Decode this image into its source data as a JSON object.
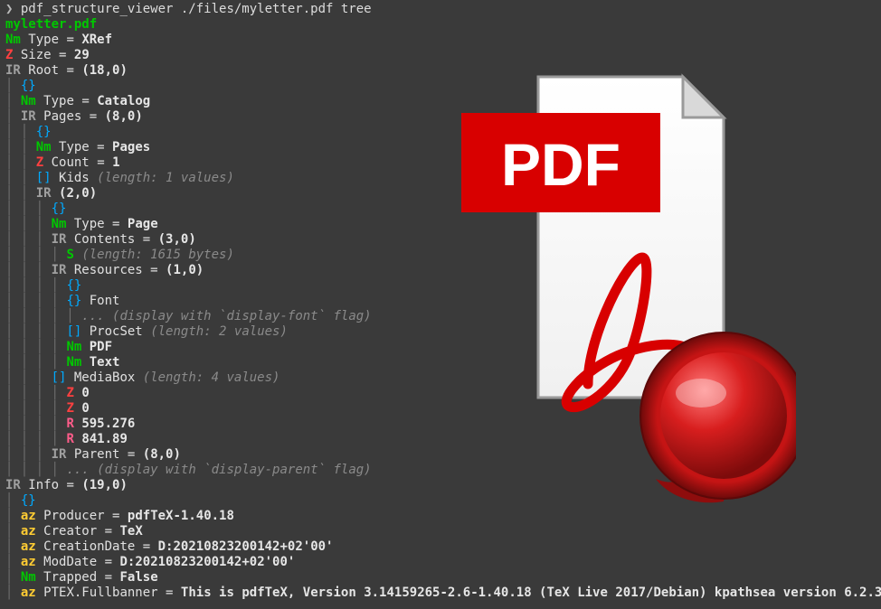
{
  "prompt": "❯",
  "command": "pdf_structure_viewer ./files/myletter.pdf tree",
  "filename": "myletter.pdf",
  "root": {
    "type_tag": "Nm",
    "type_key": "Type",
    "type_val": "XRef",
    "size_tag": "Z",
    "size_key": "Size",
    "size_val": "29",
    "root_tag": "IR",
    "root_key": "Root",
    "root_val": "(18,0)"
  },
  "catalog": {
    "type_tag": "Nm",
    "type_key": "Type",
    "type_val": "Catalog",
    "pages_tag": "IR",
    "pages_key": "Pages",
    "pages_val": "(8,0)"
  },
  "pages": {
    "type_tag": "Nm",
    "type_key": "Type",
    "type_val": "Pages",
    "count_tag": "Z",
    "count_key": "Count",
    "count_val": "1",
    "kids_tag": "[]",
    "kids_key": "Kids",
    "kids_comment": "(length: 1 values)",
    "kid_tag": "IR",
    "kid_val": "(2,0)"
  },
  "page": {
    "type_tag": "Nm",
    "type_key": "Type",
    "type_val": "Page",
    "contents_tag": "IR",
    "contents_key": "Contents",
    "contents_val": "(3,0)",
    "stream_tag": "S",
    "stream_comment": "(length: 1615 bytes)",
    "resources_tag": "IR",
    "resources_key": "Resources",
    "resources_val": "(1,0)",
    "parent_tag": "IR",
    "parent_key": "Parent",
    "parent_val": "(8,0)",
    "parent_comment": "(display with `display-parent` flag)"
  },
  "resources": {
    "font_tag": "{}",
    "font_key": "Font",
    "font_comment": "(display with `display-font` flag)",
    "procset_tag": "[]",
    "procset_key": "ProcSet",
    "procset_comment": "(length: 2 values)",
    "proc1_tag": "Nm",
    "proc1_val": "PDF",
    "proc2_tag": "Nm",
    "proc2_val": "Text"
  },
  "mediabox": {
    "tag": "[]",
    "key": "MediaBox",
    "comment": "(length: 4 values)",
    "v1_tag": "Z",
    "v1": "0",
    "v2_tag": "Z",
    "v2": "0",
    "v3_tag": "R",
    "v3": "595.276",
    "v4_tag": "R",
    "v4": "841.89"
  },
  "info_ref": {
    "tag": "IR",
    "key": "Info",
    "val": "(19,0)"
  },
  "info": {
    "producer_tag": "az",
    "producer_key": "Producer",
    "producer_val": "pdfTeX-1.40.18",
    "creator_tag": "az",
    "creator_key": "Creator",
    "creator_val": "TeX",
    "cdate_tag": "az",
    "cdate_key": "CreationDate",
    "cdate_val": "D:20210823200142+02'00'",
    "mdate_tag": "az",
    "mdate_key": "ModDate",
    "mdate_val": "D:20210823200142+02'00'",
    "trapped_tag": "Nm",
    "trapped_key": "Trapped",
    "trapped_val": "False",
    "banner_tag": "az",
    "banner_key": "PTEX.Fullbanner",
    "banner_val": "This is pdfTeX, Version 3.14159265-2.6-1.40.18 (TeX Live 2017/Debian) kpathsea version 6.2.3"
  },
  "brace": "{}",
  "ellipsis": "...",
  "pdf_badge": "PDF"
}
